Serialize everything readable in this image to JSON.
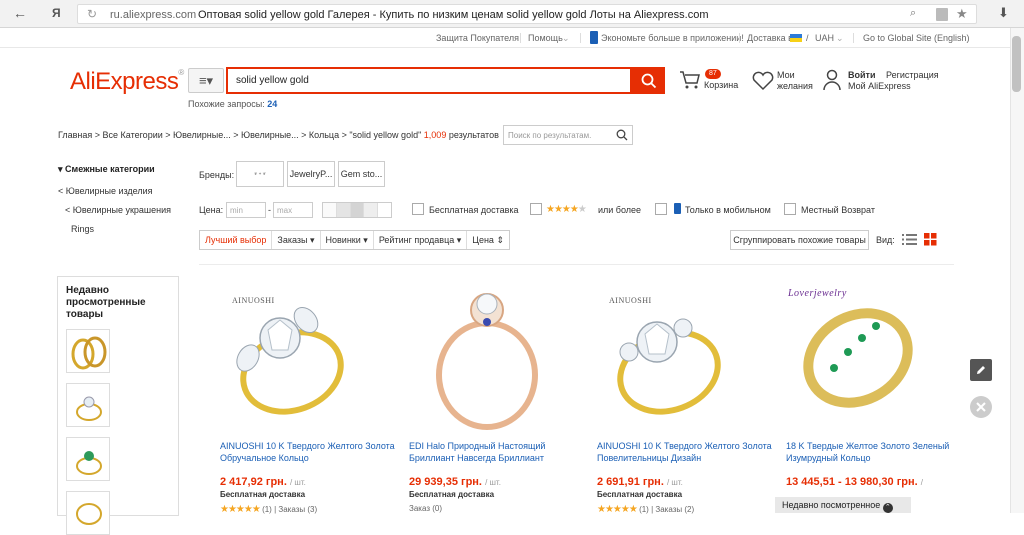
{
  "browser": {
    "back": "←",
    "ya": "Я",
    "domain": "ru.aliexpress.com",
    "page_title": "Оптовая solid yellow gold Галерея - Купить по низким ценам solid yellow gold Лоты на Aliexpress.com"
  },
  "util": {
    "protection": "Защита Покупателя",
    "help": "Помощь",
    "app": "Экономьте больше в приложении!",
    "delivery": "Доставка в",
    "currency": "UAH",
    "global": "Go to Global Site (English)"
  },
  "header": {
    "logo": "AliExpress",
    "search_value": "solid yellow gold",
    "related_label": "Похожие запросы:",
    "related_count": "24",
    "cart_count": "87",
    "cart_label": "Корзина",
    "wish_line1": "Мои",
    "wish_line2": "желания",
    "signin": "Войти",
    "register": "Регистрация",
    "my_ali": "Мой AliExpress"
  },
  "breadcrumb": {
    "path": "Главная > Все Категории > Ювелирные... > Ювелирные... > Кольца > \"solid yellow gold\"",
    "count": "1,009",
    "results": "результатов",
    "search_placeholder": "Поиск по результатам."
  },
  "sidebar": {
    "related_title": "Смежные категории",
    "items": [
      "< Ювелирные изделия",
      "< Ювелирные украшения",
      "Rings"
    ],
    "recent_title": "Недавно просмотренные товары"
  },
  "filters": {
    "brands_label": "Бренды:",
    "brands": [
      "",
      "JewelryP...",
      "Gem sto..."
    ],
    "price_label": "Цена:",
    "min_placeholder": "min",
    "dash": "-",
    "max_placeholder": "max",
    "free_shipping": "Бесплатная доставка",
    "rating_or_more": "или более",
    "mobile_only": "Только в мобильном",
    "local_return": "Местный Возврат"
  },
  "sort": {
    "items": [
      "Лучший выбор",
      "Заказы",
      "Новинки",
      "Рейтинг продавца",
      "Цена"
    ],
    "group": "Сгруппировать похожие товары",
    "view_label": "Вид:"
  },
  "products": [
    {
      "brand": "AINUOSHI",
      "title": "AINUOSHI 10 K Твердого Желтого Золота Обручальное Кольцо",
      "price": "2 417,92 грн.",
      "unit": "/ шт.",
      "shipping": "Бесплатная доставка",
      "reviews": "(1)",
      "orders": "Заказы (3)"
    },
    {
      "brand": "",
      "title": "EDI Halo Природный Настоящий Бриллиант Навсегда Бриллиант",
      "price": "29 939,35 грн.",
      "unit": "/ шт.",
      "shipping": "Бесплатная доставка",
      "reviews": "",
      "orders": "Заказ (0)"
    },
    {
      "brand": "AINUOSHI",
      "title": "AINUOSHI 10 K Твердого Желтого Золота Повелительницы Дизайн",
      "price": "2 691,91 грн.",
      "unit": "/ шт.",
      "shipping": "Бесплатная доставка",
      "reviews": "(1)",
      "orders": "Заказы (2)"
    },
    {
      "brand": "Loverjewelry",
      "title": "18 K Твердые Желтое Золото Зеленый Изумрудный Кольцо",
      "price": "13 445,51 - 13 980,30 грн.",
      "unit": "/",
      "shipping": "",
      "reviews": "",
      "orders": ""
    }
  ],
  "recent_bar": "Недавно посмотренное",
  "colors": {
    "accent": "#e62e04",
    "link": "#1b5fb5",
    "star": "#f5a623"
  }
}
